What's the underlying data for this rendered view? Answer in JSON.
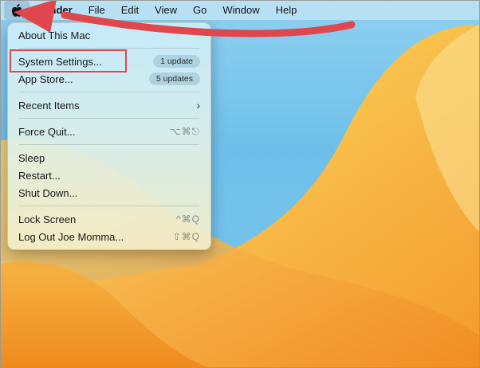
{
  "menubar": {
    "apple_icon": "apple-logo-icon",
    "items": [
      "Finder",
      "File",
      "Edit",
      "View",
      "Go",
      "Window",
      "Help"
    ]
  },
  "apple_menu": {
    "about": "About This Mac",
    "system_settings": "System Settings...",
    "system_settings_badge": "1 update",
    "app_store": "App Store...",
    "app_store_badge": "5 updates",
    "recent_items": "Recent Items",
    "force_quit": "Force Quit...",
    "force_quit_shortcut": "⌥⌘⎋",
    "sleep": "Sleep",
    "restart": "Restart...",
    "shut_down": "Shut Down...",
    "lock_screen": "Lock Screen",
    "lock_screen_shortcut": "^⌘Q",
    "log_out": "Log Out Joe Momma...",
    "log_out_shortcut": "⇧⌘Q"
  },
  "colors": {
    "annotation": "#e0474c",
    "wallpaper_orange": "#f5a53a",
    "wallpaper_blue": "#6ec0ea"
  }
}
